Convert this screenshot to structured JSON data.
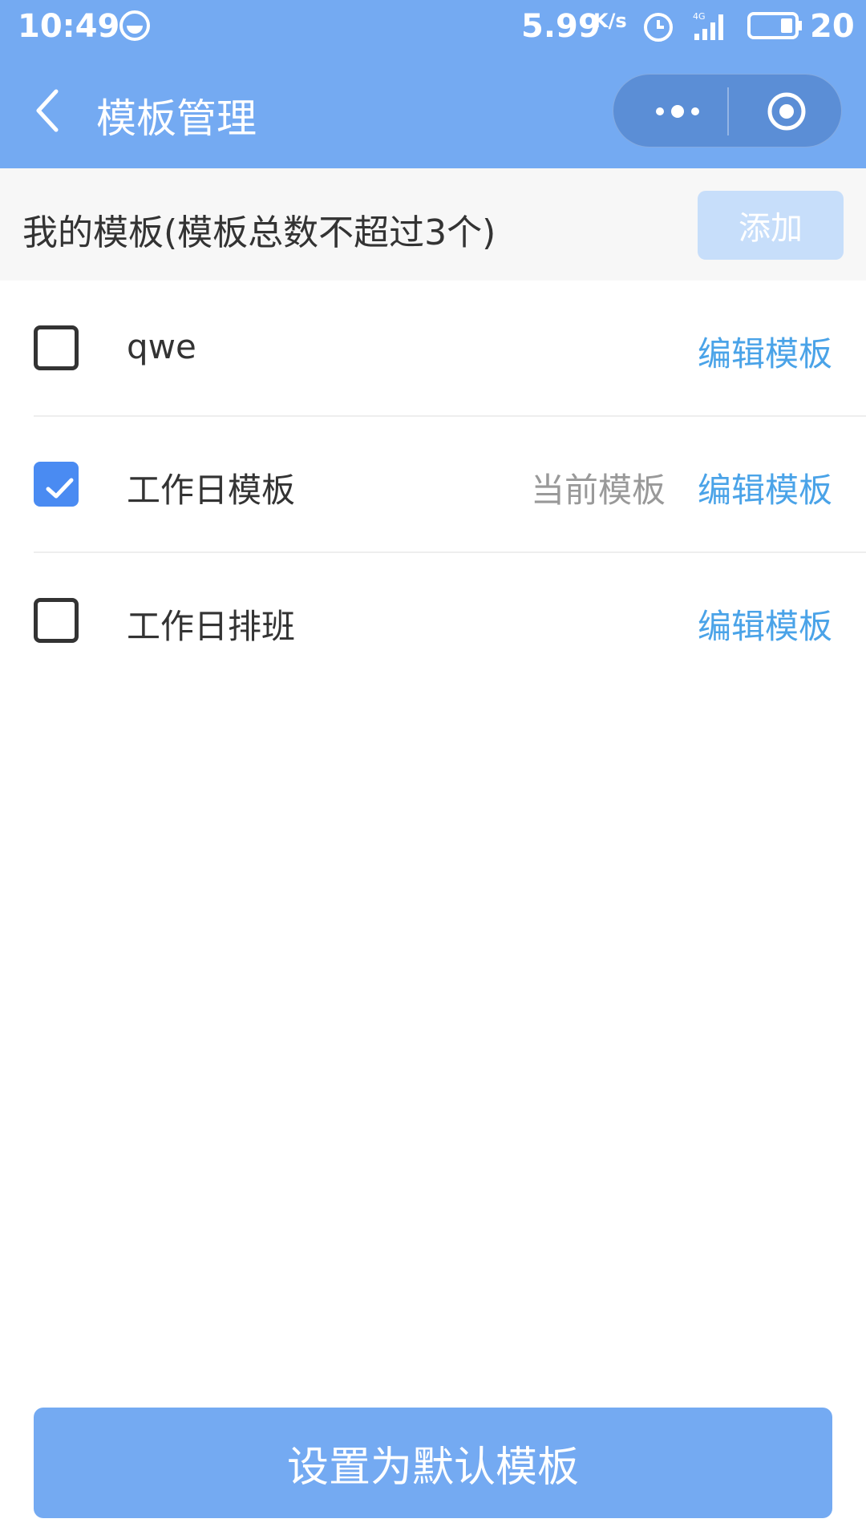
{
  "status_bar": {
    "time": "10:49",
    "speed": "5.99",
    "speed_unit": "K/s",
    "network": "4G",
    "battery": "20"
  },
  "nav": {
    "title": "模板管理",
    "back_icon": "chevron-left-icon",
    "more_icon": "more-dots-icon",
    "target_icon": "target-circle-icon"
  },
  "section": {
    "title": "我的模板(模板总数不超过3个)",
    "add_label": "添加"
  },
  "templates": [
    {
      "name": "qwe",
      "checked": false,
      "current_label": "",
      "edit_label": "编辑模板"
    },
    {
      "name": "工作日模板",
      "checked": true,
      "current_label": "当前模板",
      "edit_label": "编辑模板"
    },
    {
      "name": "工作日排班",
      "checked": false,
      "current_label": "",
      "edit_label": "编辑模板"
    }
  ],
  "footer": {
    "set_default_label": "设置为默认模板"
  },
  "colors": {
    "header_blue": "#74aaf2",
    "check_blue": "#4a8bf2",
    "link_blue": "#4aa3e8"
  }
}
